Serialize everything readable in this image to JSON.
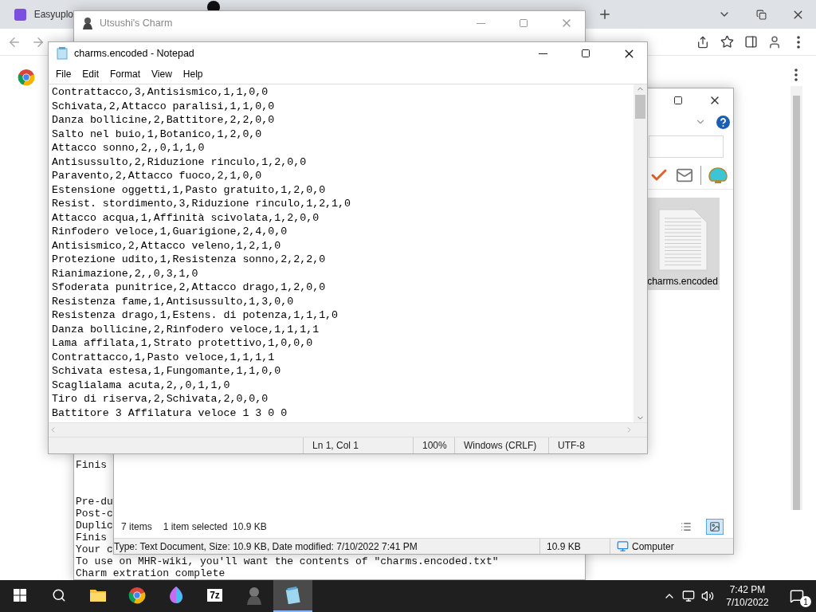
{
  "browser": {
    "tabs": [
      {
        "title": "Easyuplo",
        "kind": "site"
      },
      {
        "kind": "github"
      }
    ]
  },
  "console_window": {
    "title": "Utsushi's Charm",
    "blocks": [
      [
        "Finis"
      ],
      [
        "Pre-du",
        "Post-c",
        "Duplic",
        "Finis",
        "Your c",
        "To use on MHR-wiki, you'll want the contents of \"charms.encoded.txt\"",
        "Charm extration complete"
      ]
    ]
  },
  "explorer_window": {
    "file": {
      "name": "charms.encoded",
      "selected": true
    },
    "status": {
      "items": "7 items",
      "selection": "1 item selected",
      "size": "10.9 KB"
    },
    "views": [
      {
        "kind": "details",
        "selected": false
      },
      {
        "kind": "preview",
        "selected": true
      }
    ],
    "details": {
      "info": "Type: Text Document, Size: 10.9 KB, Date modified: 7/10/2022 7:41 PM",
      "size": "10.9 KB",
      "location": "Computer"
    }
  },
  "notepad": {
    "title": "charms.encoded - Notepad",
    "menu": [
      "File",
      "Edit",
      "Format",
      "View",
      "Help"
    ],
    "lines": [
      "Contrattacco,3,Antisismico,1,1,0,0",
      "Schivata,2,Attacco paralisi,1,1,0,0",
      "Danza bollicine,2,Battitore,2,2,0,0",
      "Salto nel buio,1,Botanico,1,2,0,0",
      "Attacco sonno,2,,0,1,1,0",
      "Antisussulto,2,Riduzione rinculo,1,2,0,0",
      "Paravento,2,Attacco fuoco,2,1,0,0",
      "Estensione oggetti,1,Pasto gratuito,1,2,0,0",
      "Resist. stordimento,3,Riduzione rinculo,1,2,1,0",
      "Attacco acqua,1,Affinità scivolata,1,2,0,0",
      "Rinfodero veloce,1,Guarigione,2,4,0,0",
      "Antisismico,2,Attacco veleno,1,2,1,0",
      "Protezione udito,1,Resistenza sonno,2,2,2,0",
      "Rianimazione,2,,0,3,1,0",
      "Sfoderata punitrice,2,Attacco drago,1,2,0,0",
      "Resistenza fame,1,Antisussulto,1,3,0,0",
      "Resistenza drago,1,Estens. di potenza,1,1,1,0",
      "Danza bollicine,2,Rinfodero veloce,1,1,1,1",
      "Lama affilata,1,Strato protettivo,1,0,0,0",
      "Contrattacco,1,Pasto veloce,1,1,1,1",
      "Schivata estesa,1,Fungomante,1,1,0,0",
      "Scaglialama acuta,2,,0,1,1,0",
      "Tiro di riserva,2,Schivata,2,0,0,0",
      "Battitore 3 Affilatura veloce 1 3 0 0"
    ],
    "status": {
      "position": "Ln 1, Col 1",
      "zoom": "100%",
      "line_endings": "Windows (CRLF)",
      "encoding": "UTF-8"
    }
  },
  "taskbar": {
    "apps": [
      {
        "kind": "explorer",
        "active": false
      },
      {
        "kind": "chrome",
        "active": false
      },
      {
        "kind": "paint",
        "active": false
      },
      {
        "kind": "archiver",
        "label": "7z",
        "active": false
      },
      {
        "kind": "charm",
        "active": false
      },
      {
        "kind": "notepad",
        "active": true
      }
    ],
    "time": "7:42 PM",
    "date": "7/10/2022",
    "notifications": "1"
  }
}
